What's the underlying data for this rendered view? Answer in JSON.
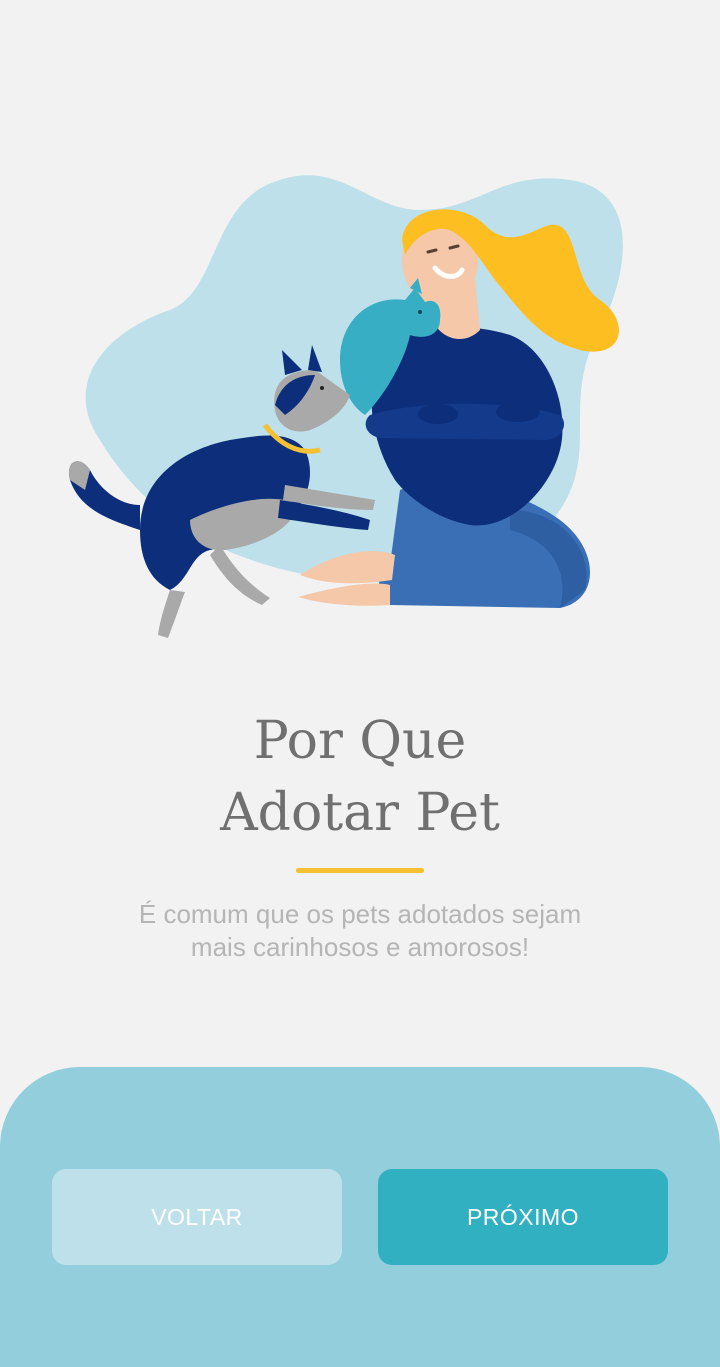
{
  "onboarding": {
    "title_line1": "Por Que",
    "title_line2": "Adotar Pet",
    "subtitle_line1": "É comum que os pets adotados sejam",
    "subtitle_line2": "mais carinhosos e amorosos!",
    "illustration": "woman-with-dog-and-cat-illustration"
  },
  "buttons": {
    "back_label": "VOLTAR",
    "next_label": "PRÓXIMO"
  },
  "colors": {
    "background": "#f2f2f2",
    "accent_underline": "#f5c034",
    "panel": "#93cedd",
    "next_button": "#31b0c2",
    "back_button": "#bde0ea",
    "title_text": "#707070",
    "subtitle_text": "#b5b5b5"
  }
}
